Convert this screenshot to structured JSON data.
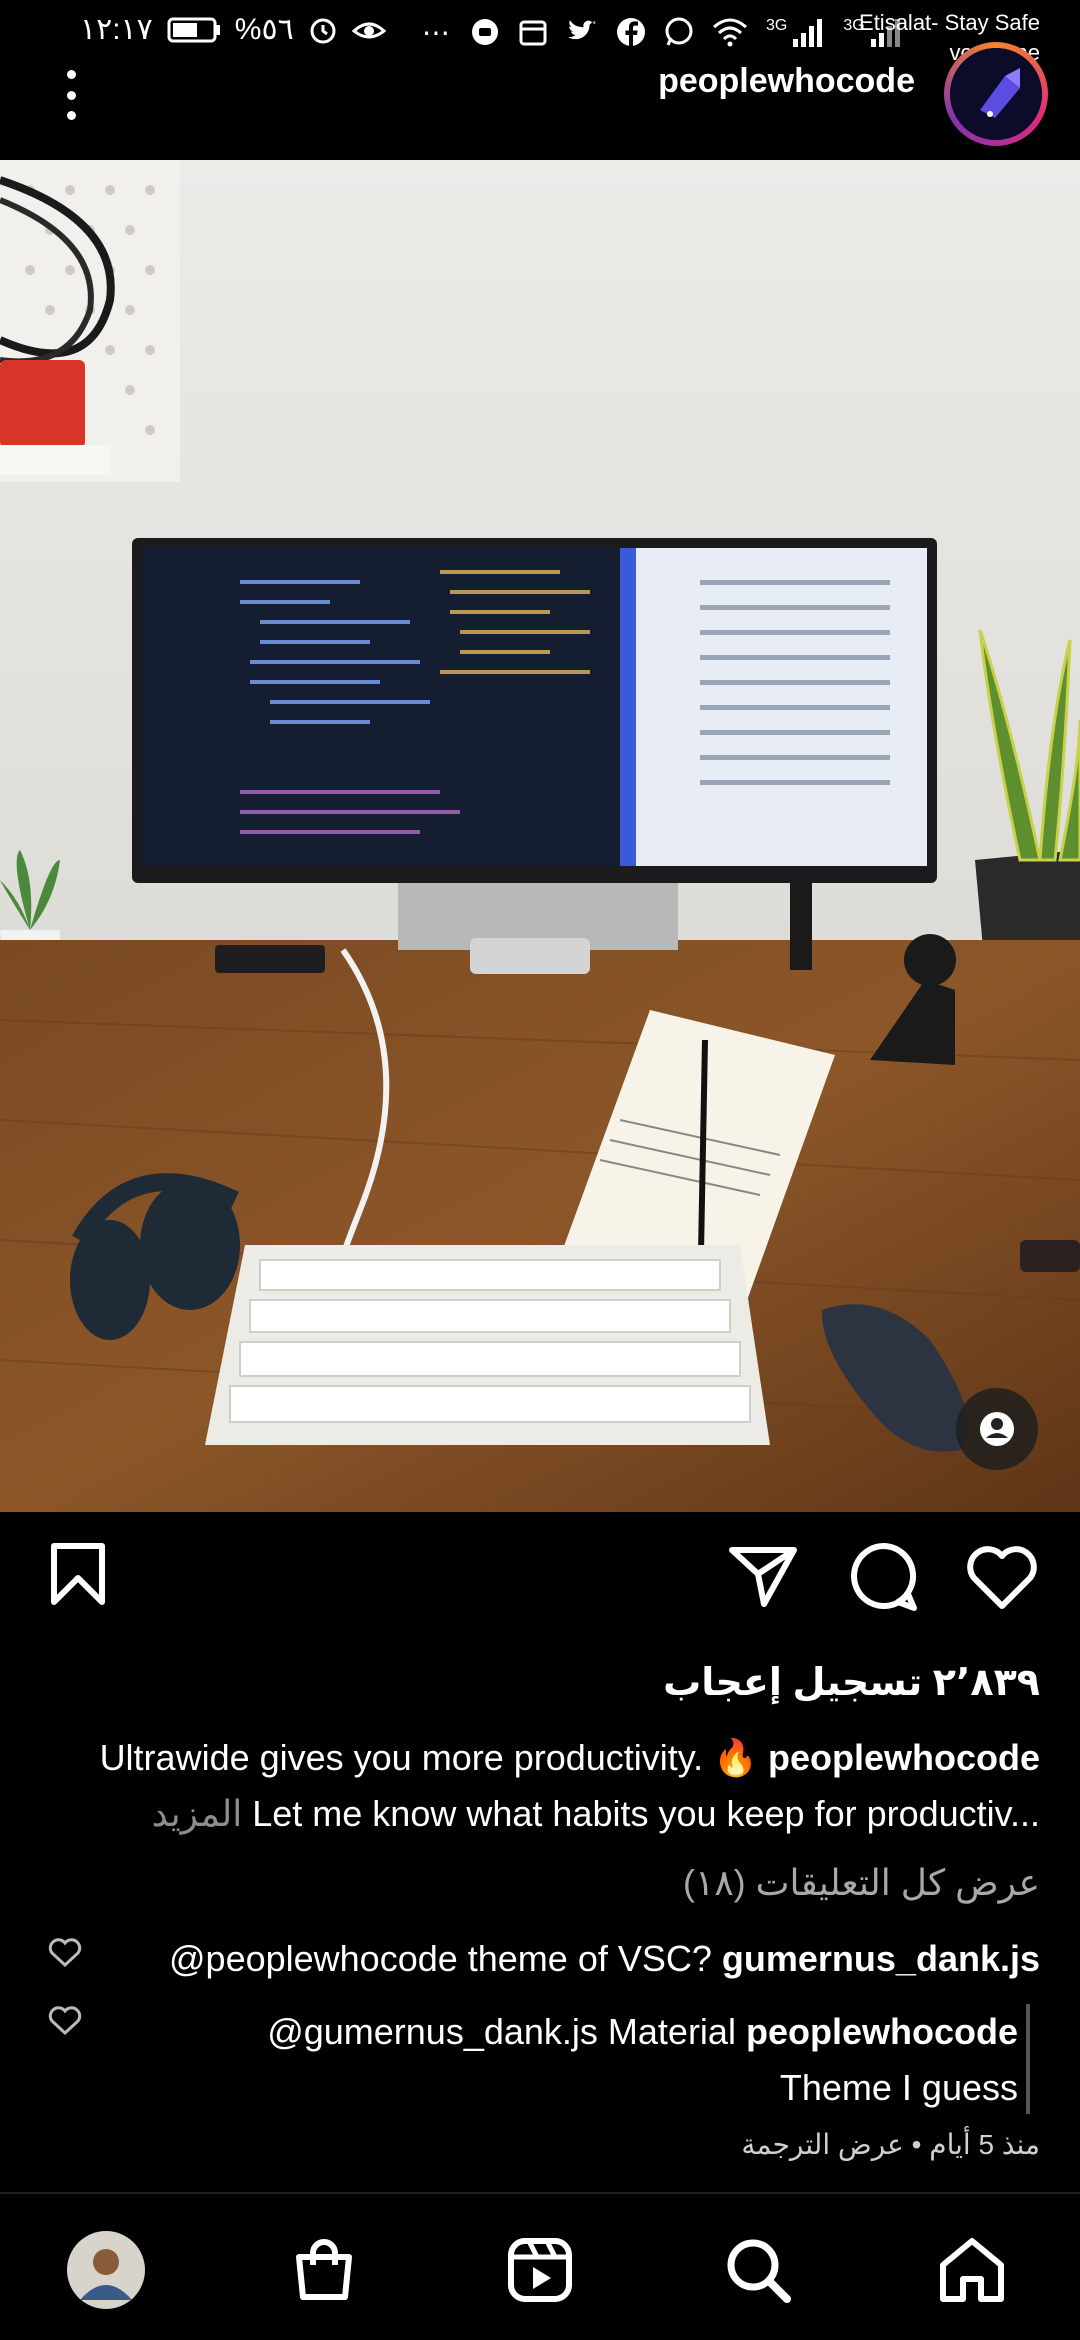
{
  "status_bar": {
    "time": "١٢:١٧",
    "battery": "%٥٦",
    "network_3g_1": "3G",
    "network_3g_2": "3G",
    "carrier_1": "Etisalat- Stay Safe",
    "carrier_2": "vodafone",
    "icons": [
      "battery-icon",
      "alarm-icon",
      "eye-icon",
      "more-dots-icon",
      "record-icon",
      "calendar-icon",
      "twitter-icon",
      "facebook-icon",
      "whatsapp-icon",
      "wifi-icon",
      "signal-icon",
      "signal-icon"
    ]
  },
  "header": {
    "username": "peoplewhocode",
    "menu_icon": "more-vertical-icon"
  },
  "post": {
    "image_subject": "desk-setup-photo",
    "likes": "٢٬٨٣٩ تسجيل إعجاب",
    "caption_username": "peoplewhocode",
    "caption_text": "Ultrawide gives you more productivity. 🔥",
    "caption_line2": "Let me know what habits you keep for productiv...",
    "caption_more": "المزيد",
    "view_all_comments": "عرض كل التعليقات (١٨)",
    "comments": [
      {
        "username": "gumernus_dank.js",
        "text": "@peoplewhocode theme of VSC?"
      },
      {
        "username": "peoplewhocode",
        "text": "@gumernus_dank.js Material",
        "text_line2": "Theme I guess"
      }
    ],
    "meta_time": "منذ 5 أيام",
    "meta_sep": "•",
    "meta_translate": "عرض الترجمة"
  },
  "actions": [
    "heart-icon",
    "comment-icon",
    "share-icon",
    "bookmark-icon"
  ],
  "nav": [
    "home-icon",
    "search-icon",
    "reels-icon",
    "shop-icon",
    "profile-avatar"
  ],
  "colors": {
    "background": "#000000",
    "text": "#ffffff",
    "muted": "#a8a8a8"
  }
}
